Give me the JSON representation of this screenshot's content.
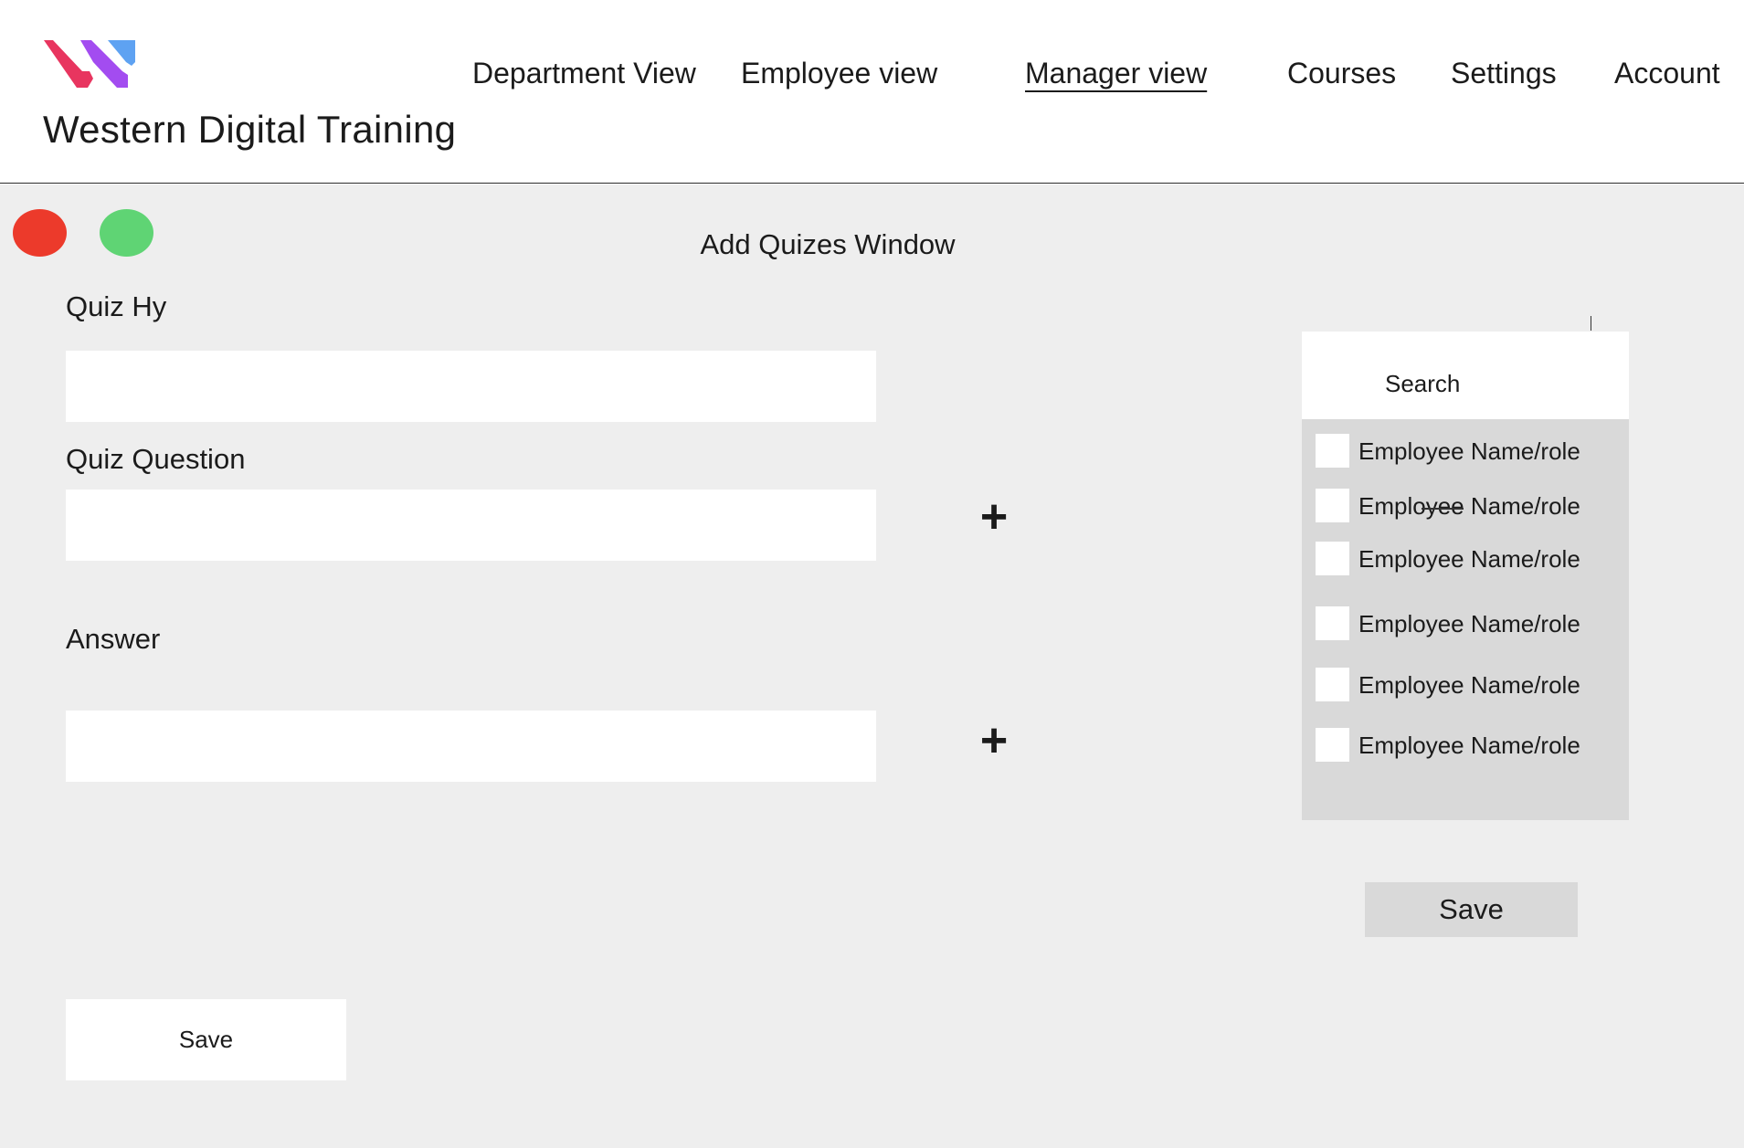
{
  "header": {
    "brand": "Western Digital Training",
    "logo_colors": [
      "#e8355f",
      "#a34cf0",
      "#5ea2f2"
    ],
    "nav": [
      {
        "label": "Department View",
        "active": false
      },
      {
        "label": "Employee view",
        "active": false
      },
      {
        "label": "Manager view",
        "active": true
      },
      {
        "label": "Courses",
        "active": false
      },
      {
        "label": "Settings",
        "active": false
      },
      {
        "label": "Account",
        "active": false
      }
    ]
  },
  "window": {
    "title": "Add Quizes Window",
    "controls": {
      "close_color": "#ec3a2b",
      "maximize_color": "#5fd474"
    }
  },
  "form": {
    "quiz_name_label": "Quiz Hy",
    "quiz_name_value": "",
    "quiz_question_label": "Quiz Question",
    "quiz_question_value": "",
    "answer_label": "Answer",
    "answer_value": "",
    "add_icon": "+",
    "save_label": "Save"
  },
  "assign_panel": {
    "search_placeholder": "Search",
    "employees": [
      {
        "label": "Employee Name/role",
        "checked": false
      },
      {
        "label": "Employee Name/role",
        "checked": false
      },
      {
        "label": "Employee Name/role",
        "checked": false
      },
      {
        "label": "Employee Name/role",
        "checked": false
      },
      {
        "label": "Employee Name/role",
        "checked": false
      },
      {
        "label": "Employee Name/role",
        "checked": false
      }
    ],
    "save_label": "Save"
  }
}
